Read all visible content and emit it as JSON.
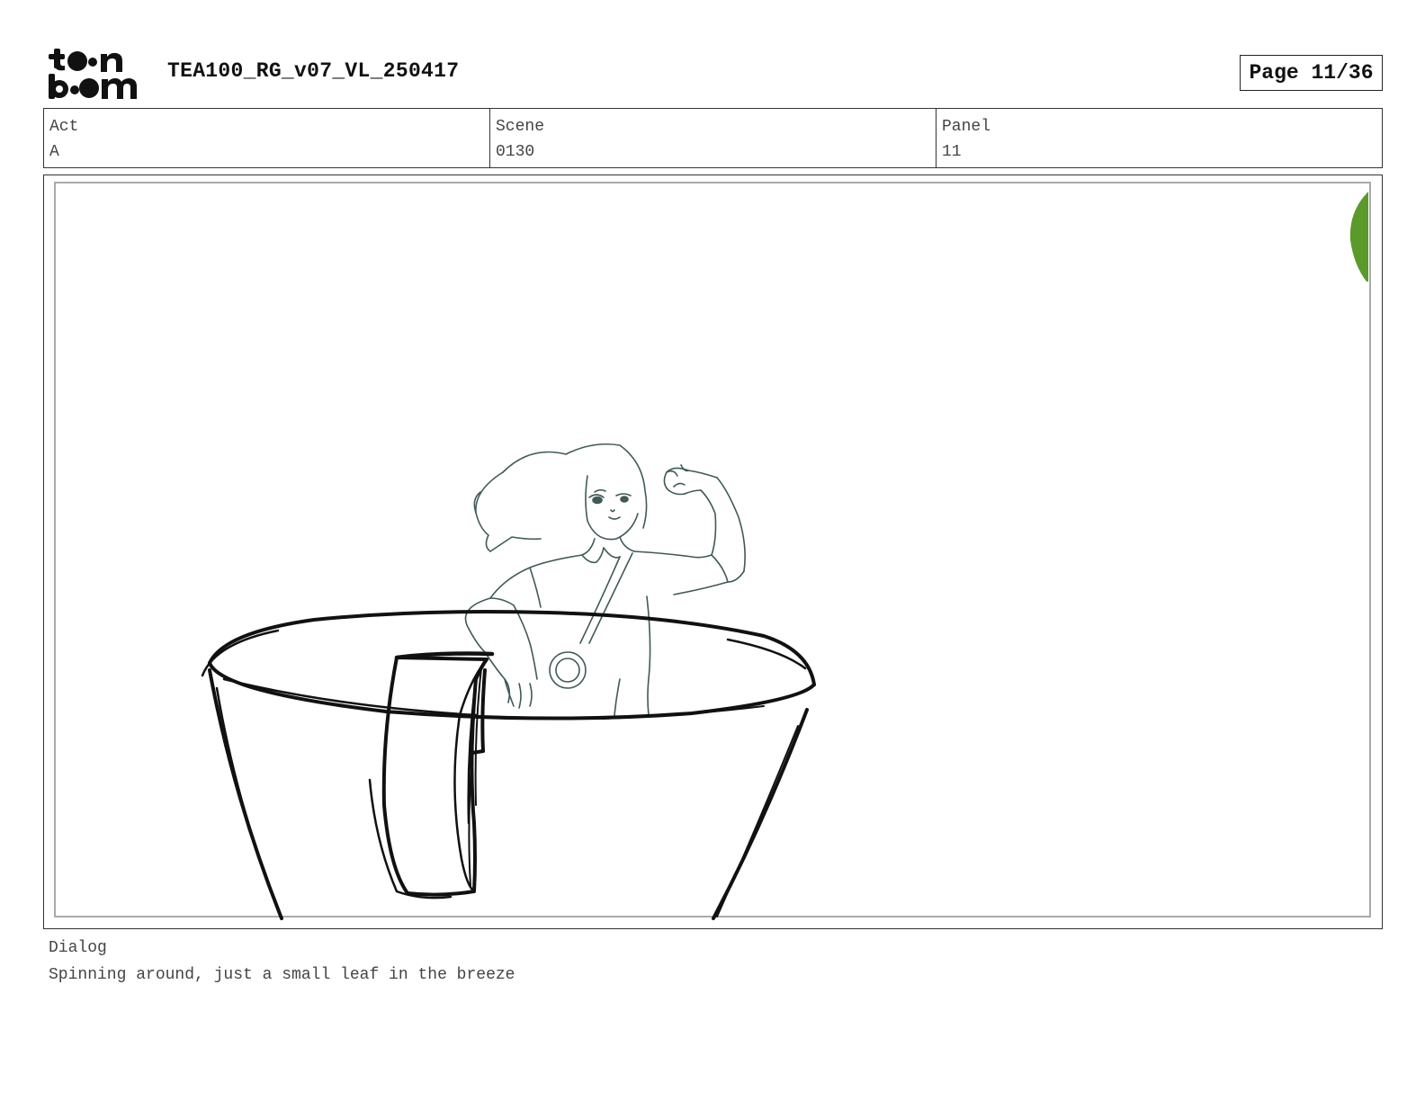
{
  "header": {
    "logo_text": "toon boom",
    "title": "TEA100_RG_v07_VL_250417",
    "page": "Page 11/36"
  },
  "meta": {
    "act_label": "Act",
    "act_value": "A",
    "scene_label": "Scene",
    "scene_value": "0130",
    "panel_label": "Panel",
    "panel_value": "11"
  },
  "panel": {
    "icons": [
      "teacup-sketch",
      "character-sketch",
      "leaf-edge"
    ],
    "colors": {
      "ink": "#111111",
      "character_line": "#3f5a58",
      "leaf": "#5a9a2a"
    }
  },
  "dialog": {
    "label": "Dialog",
    "text": "Spinning around, just a small leaf in the breeze"
  }
}
